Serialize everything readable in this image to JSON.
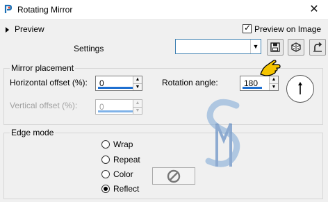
{
  "window": {
    "title": "Rotating Mirror",
    "close_icon": "close-icon"
  },
  "preview": {
    "label": "Preview",
    "preview_on_image_label": "Preview on Image",
    "preview_on_image_checked": true
  },
  "settings": {
    "label": "Settings",
    "preset_value": ""
  },
  "mirror_placement": {
    "title": "Mirror placement",
    "horizontal_offset_label": "Horizontal offset (%):",
    "horizontal_offset_value": "0",
    "vertical_offset_label": "Vertical offset (%):",
    "vertical_offset_value": "0",
    "rotation_angle_label": "Rotation angle:",
    "rotation_angle_value": "180"
  },
  "edge_mode": {
    "title": "Edge mode",
    "options": [
      "Wrap",
      "Repeat",
      "Color",
      "Reflect"
    ],
    "selected": "Reflect"
  },
  "colors": {
    "accent": "#1e6fd0",
    "cursor": "#f5c400",
    "watermark": "#7aa7d6"
  }
}
